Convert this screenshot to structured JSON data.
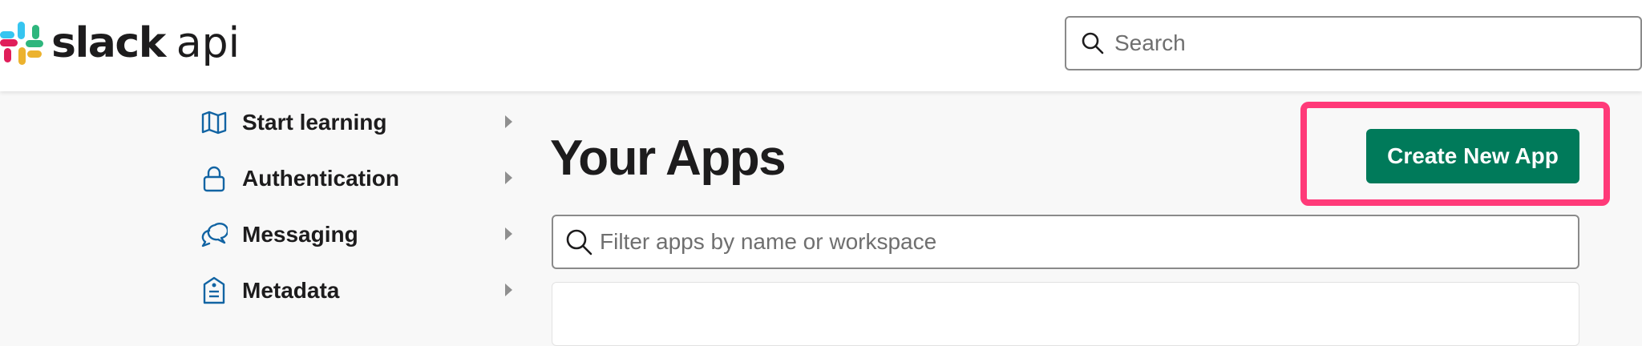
{
  "header": {
    "brand": "slack",
    "brand_suffix": "api",
    "search": {
      "placeholder": "Search",
      "icon": "search-icon"
    }
  },
  "sidebar": {
    "items": [
      {
        "label": "Start learning",
        "icon": "map-icon"
      },
      {
        "label": "Authentication",
        "icon": "lock-icon"
      },
      {
        "label": "Messaging",
        "icon": "chat-bubbles-icon"
      },
      {
        "label": "Metadata",
        "icon": "tag-icon"
      }
    ]
  },
  "main": {
    "title": "Your Apps",
    "create_button": "Create New App",
    "filter": {
      "placeholder": "Filter apps by name or workspace",
      "icon": "search-icon"
    }
  },
  "colors": {
    "accent_green": "#007a5a",
    "highlight_pink": "#ff3a79",
    "icon_blue": "#1264a3",
    "text": "#1d1c1d"
  }
}
